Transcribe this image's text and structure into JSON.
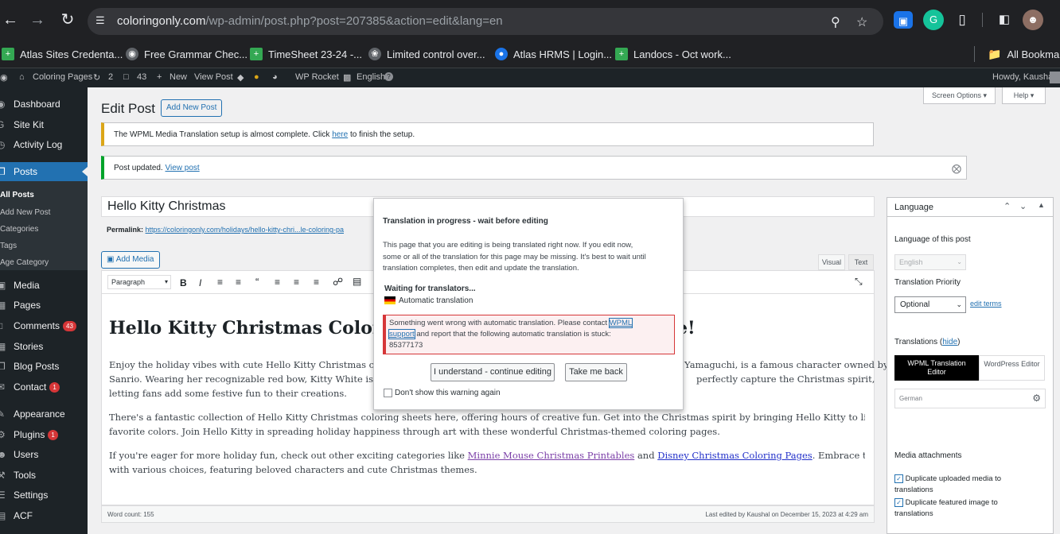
{
  "browser": {
    "url_host": "coloringonly.com",
    "url_path": "/wp-admin/post.php?post=207385&action=edit&lang=en",
    "bookmarks": [
      {
        "label": "Atlas Sites Credenta...",
        "color": "#34a853"
      },
      {
        "label": "Free Grammar Chec...",
        "color": "#5f6368"
      },
      {
        "label": "TimeSheet 23-24 -...",
        "color": "#34a853"
      },
      {
        "label": "Limited control over...",
        "color": "#5f6368"
      },
      {
        "label": "Atlas HRMS | Login...",
        "color": "#1a73e8"
      },
      {
        "label": "Landocs - Oct work...",
        "color": "#34a853"
      }
    ],
    "all_bookmarks": "All Bookmarks"
  },
  "adminbar": {
    "site_name": "Coloring Pages",
    "updates": "2",
    "comments": "43",
    "new": "New",
    "view_post": "View Post",
    "wp_rocket": "WP Rocket",
    "language": "English",
    "howdy": "Howdy, Kaushal"
  },
  "menu": {
    "dashboard": "Dashboard",
    "site_kit": "Site Kit",
    "activity_log": "Activity Log",
    "posts": "Posts",
    "all_posts": "All Posts",
    "add_new_post": "Add New Post",
    "categories": "Categories",
    "tags": "Tags",
    "age_category": "Age Category",
    "media": "Media",
    "pages": "Pages",
    "comments": "Comments",
    "comments_count": "43",
    "stories": "Stories",
    "blog_posts": "Blog Posts",
    "contact": "Contact",
    "contact_count": "1",
    "appearance": "Appearance",
    "plugins": "Plugins",
    "plugins_count": "1",
    "users": "Users",
    "tools": "Tools",
    "settings": "Settings",
    "acf": "ACF"
  },
  "page": {
    "title": "Edit Post",
    "add_new": "Add New Post",
    "screen_options": "Screen Options",
    "help": "Help",
    "notice1_before": "The WPML Media Translation setup is almost complete. Click",
    "notice1_link": "here",
    "notice1_after": "to finish the setup.",
    "notice2_text": "Post updated.",
    "notice2_link": "View post",
    "post_title": "Hello Kitty Christmas",
    "permalink_label": "Permalink:",
    "permalink_url": "https://coloringonly.com/holidays/hello-kitty-chri...le-coloring-pa",
    "add_media": "Add Media",
    "tab_visual": "Visual",
    "tab_text": "Text",
    "format_select": "Paragraph"
  },
  "content": {
    "heading_left": "Hello Kitty Christmas Colori",
    "heading_right": "e!",
    "p1_line1_left": "Enjoy the holiday vibes with cute Hello Kitty Christmas colorin",
    "p1_line1_right": "Yamaguchi, is a famous character owned by",
    "p1_line2_left": "Sanrio. Wearing her recognizable red bow, Kitty White is loved",
    "p1_line2_right": "perfectly capture the Christmas spirit,",
    "p1_line3": "letting fans add some festive fun to their creations.",
    "p2_line1": "There's a fantastic collection of Hello Kitty Christmas coloring sheets here, offering hours of creative fun. Get into the Christmas spirit by bringing Hello Kitty to life with your",
    "p2_line2": "favorite colors. Join Hello Kitty in spreading holiday happiness through art with these wonderful Christmas-themed coloring pages.",
    "p3_before": "If you're eager for more holiday fun, check out other exciting categories like",
    "p3_link1": "Minnie Mouse Christmas Printables",
    "p3_and": "and",
    "p3_link2": "Disney Christmas Coloring Pages",
    "p3_after": ". Embrace the festive magic",
    "p3_line2": "with various choices, featuring beloved characters and cute Christmas themes.",
    "word_count": "Word count: 155",
    "last_edited": "Last edited by Kaushal on December 15, 2023 at 4:29 am"
  },
  "modal": {
    "title": "Translation in progress - wait before editing",
    "body_line1": "This page that you are editing is being translated right now. If you edit now,",
    "body_line2": "some or all of the translation for this page may be missing. It's best to wait until",
    "body_line3": "translation completes, then edit and update the translation.",
    "waiting": "Waiting for translators...",
    "auto_translation": "Automatic translation",
    "error_before": "Something went wrong with automatic translation. Please contact",
    "error_link1": "WPML",
    "error_link2": "support",
    "error_after": "and report that the following automatic translation is stuck:",
    "error_id": "85377173",
    "continue_button": "I understand - continue editing",
    "back_button": "Take me back",
    "dont_show": "Don't show this warning again"
  },
  "language_box": {
    "title": "Language",
    "language_of_post": "Language of this post",
    "language_value": "English",
    "translation_priority": "Translation Priority",
    "priority_value": "Optional",
    "edit_terms": "edit terms",
    "translations": "Translations",
    "hide": "hide",
    "wpml_editor_line1": "WPML Translation",
    "wpml_editor_line2": "Editor",
    "wordpress_editor": "WordPress Editor",
    "german": "German",
    "media_attachments": "Media attachments",
    "dup_media_line1": "Duplicate uploaded media to",
    "dup_media_line2": "translations",
    "dup_featured_line1": "Duplicate featured image to",
    "dup_featured_line2": "translations"
  }
}
